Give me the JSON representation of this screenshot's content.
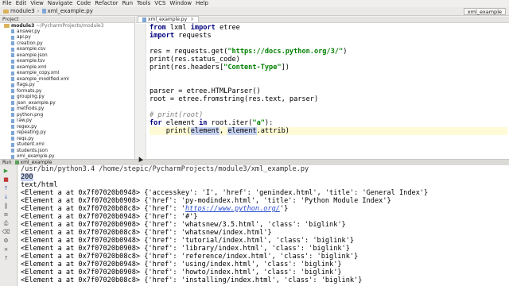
{
  "menubar": {
    "items": [
      "File",
      "Edit",
      "View",
      "Navigate",
      "Code",
      "Refactor",
      "Run",
      "Tools",
      "VCS",
      "Window",
      "Help"
    ]
  },
  "toolbar": {
    "crumbs": [
      "module3",
      "xml_example.py"
    ],
    "run_config": "xml_example"
  },
  "project": {
    "header": "Project",
    "root_name": "module3",
    "root_path": "~/PycharmProjects/module3",
    "files": [
      "answer.py",
      "api.py",
      "creation.py",
      "example.csv",
      "example.json",
      "example.tsv",
      "example.xml",
      "example_copy.xml",
      "example_modified.xml",
      "flags.py",
      "formats.py",
      "grouping.py",
      "json_example.py",
      "methods.py",
      "python.png",
      "raw.py",
      "regex.py",
      "repeating.py",
      "reqs.py",
      "student.xml",
      "students.json",
      "xml_example.py"
    ]
  },
  "editor": {
    "tab_label": "xml_example.py",
    "code": {
      "l1_kw1": "from",
      "l1_mod": " lxml ",
      "l1_kw2": "import",
      "l1_rest": " etree",
      "l2_kw": "import",
      "l2_rest": " requests",
      "l4_a": "res = requests.get(",
      "l4_str": "\"https://docs.python.org/3/\"",
      "l4_b": ")",
      "l5": "print(res.status_code)",
      "l6_a": "print(res.headers[",
      "l6_str": "\"Content-Type\"",
      "l6_b": "])",
      "l9": "parser = etree.HTMLParser()",
      "l10": "root = etree.fromstring(res.text, parser)",
      "l12": "# print(root)",
      "l13_kw1": "for",
      "l13_a": " element ",
      "l13_kw2": "in",
      "l13_b": " root.iter(",
      "l13_str": "\"a\"",
      "l13_c": "):",
      "l14_a": "    print(",
      "l14_hl1": "element",
      "l14_b": ", ",
      "l14_hl2": "element",
      "l14_c": ".attrib)"
    }
  },
  "run": {
    "label": "Run",
    "tab": "xml_example",
    "command": "/usr/bin/python3.4 /home/stepic/PycharmProjects/module3/xml_example.py",
    "status": "200",
    "content_type": "text/html",
    "lines": [
      "<Element a at 0x7f07020b0948> {'accesskey': 'I', 'href': 'genindex.html', 'title': 'General Index'}",
      "<Element a at 0x7f07020b0908> {'href': 'py-modindex.html', 'title': 'Python Module Index'}",
      "<Element a at 0x7f07020b08c8> {'href': '",
      "<Element a at 0x7f07020b0948> {'href': '#'}",
      "<Element a at 0x7f07020b0908> {'href': 'whatsnew/3.5.html', 'class': 'biglink'}",
      "<Element a at 0x7f07020b08c8> {'href': 'whatsnew/index.html'}",
      "<Element a at 0x7f07020b0948> {'href': 'tutorial/index.html', 'class': 'biglink'}",
      "<Element a at 0x7f07020b0908> {'href': 'library/index.html', 'class': 'biglink'}",
      "<Element a at 0x7f07020b08c8> {'href': 'reference/index.html', 'class': 'biglink'}",
      "<Element a at 0x7f07020b0948> {'href': 'using/index.html', 'class': 'biglink'}",
      "<Element a at 0x7f07020b0908> {'href': 'howto/index.html', 'class': 'biglink'}",
      "<Element a at 0x7f07020b08c8> {'href': 'installing/index.html', 'class': 'biglink'}"
    ],
    "link_url": "https://www.python.org/",
    "link_tail": "'}"
  }
}
